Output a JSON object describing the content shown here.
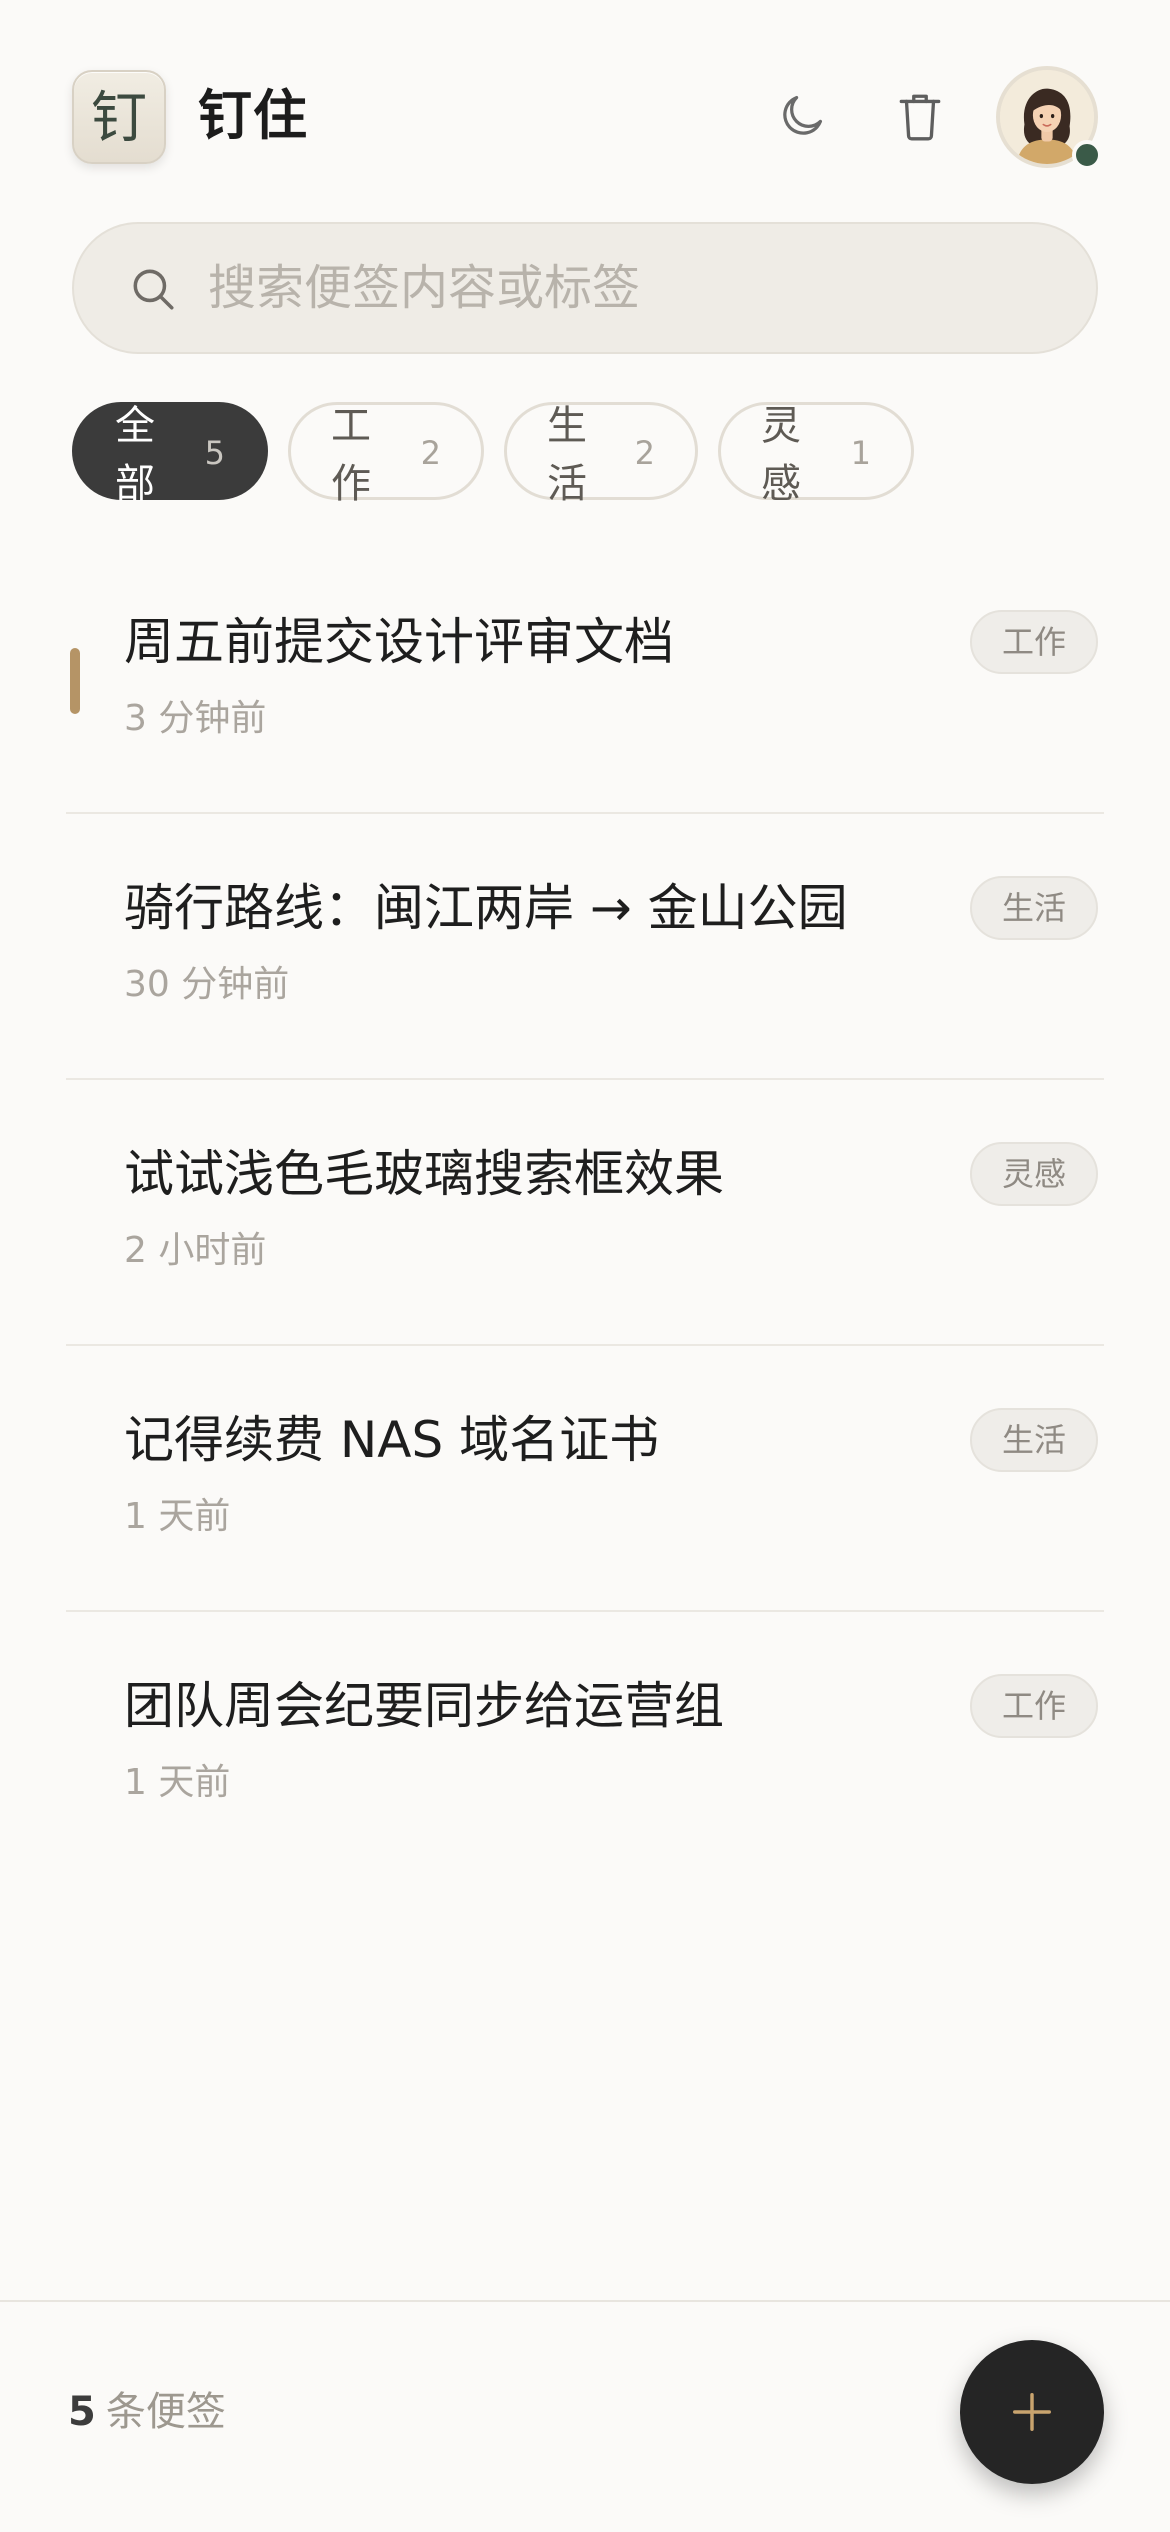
{
  "app": {
    "logo_char": "钉",
    "title": "钉住"
  },
  "header": {
    "icons": [
      "moon-icon",
      "trash-icon"
    ],
    "user_online": true
  },
  "search": {
    "placeholder": "搜索便签内容或标签",
    "value": ""
  },
  "filters": [
    {
      "label": "全部",
      "count": "5",
      "active": true
    },
    {
      "label": "工作",
      "count": "2",
      "active": false
    },
    {
      "label": "生活",
      "count": "2",
      "active": false
    },
    {
      "label": "灵感",
      "count": "1",
      "active": false
    }
  ],
  "notes": [
    {
      "title": "周五前提交设计评审文档",
      "time": "3 分钟前",
      "tag": "工作",
      "pinned": true
    },
    {
      "title": "骑行路线：闽江两岸 → 金山公园",
      "time": "30 分钟前",
      "tag": "生活",
      "pinned": false
    },
    {
      "title": "试试浅色毛玻璃搜索框效果",
      "time": "2 小时前",
      "tag": "灵感",
      "pinned": false
    },
    {
      "title": "记得续费 NAS 域名证书",
      "time": "1 天前",
      "tag": "生活",
      "pinned": false
    },
    {
      "title": "团队周会纪要同步给运营组",
      "time": "1 天前",
      "tag": "工作",
      "pinned": false
    }
  ],
  "footer": {
    "count": "5",
    "count_label": "条便签"
  },
  "colors": {
    "background": "#fbfaf8",
    "accent_pin": "#b59466",
    "active_chip": "#3b3b3b",
    "fab": "#252525",
    "fab_plus": "#c9a46e",
    "online": "#3a5a48"
  }
}
